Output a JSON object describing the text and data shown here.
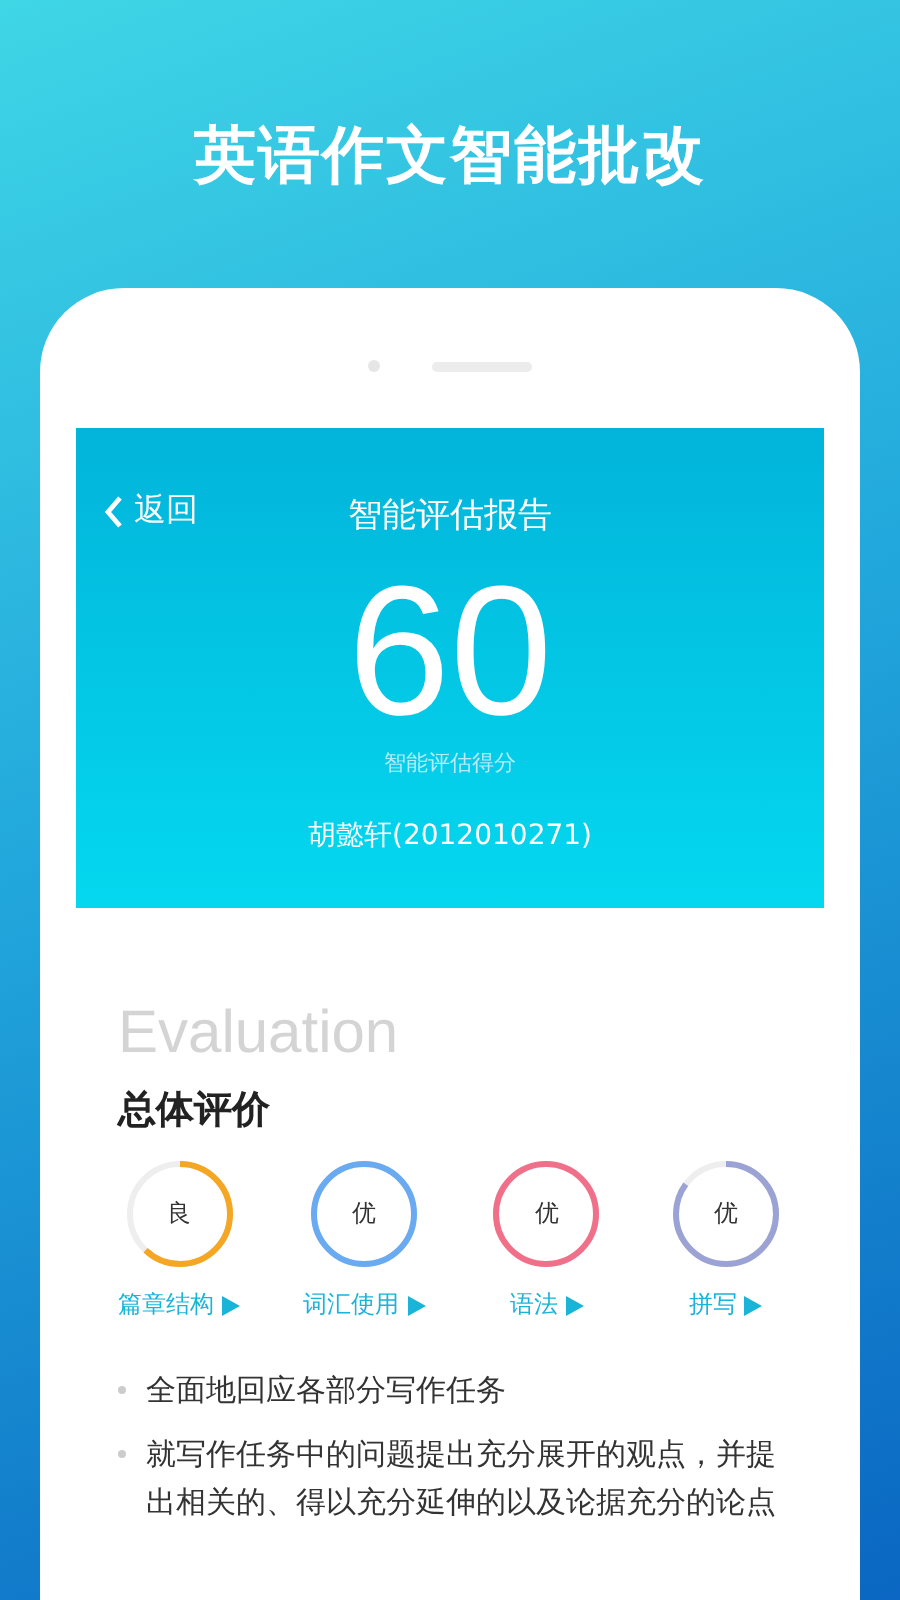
{
  "headline": "英语作文智能批改",
  "header": {
    "back": "返回",
    "title": "智能评估报告",
    "score": "60",
    "score_label": "智能评估得分",
    "student": "胡懿轩(2012010271)"
  },
  "section_watermark": "Evaluation",
  "section_title": "总体评价",
  "ratings": [
    {
      "grade": "良",
      "label": "篇章结构",
      "level": 0.62,
      "color": "#f5a623"
    },
    {
      "grade": "优",
      "label": "词汇使用",
      "level": 1,
      "color": "#6aaaf0"
    },
    {
      "grade": "优",
      "label": "语法",
      "level": 1,
      "color": "#f0708a"
    },
    {
      "grade": "优",
      "label": "拼写",
      "level": 0.85,
      "color": "#9aa3d4"
    }
  ],
  "bullets": [
    "全面地回应各部分写作任务",
    "就写作任务中的问题提出充分展开的观点，并提出相关的、得以充分延伸的以及论据充分的论点"
  ]
}
